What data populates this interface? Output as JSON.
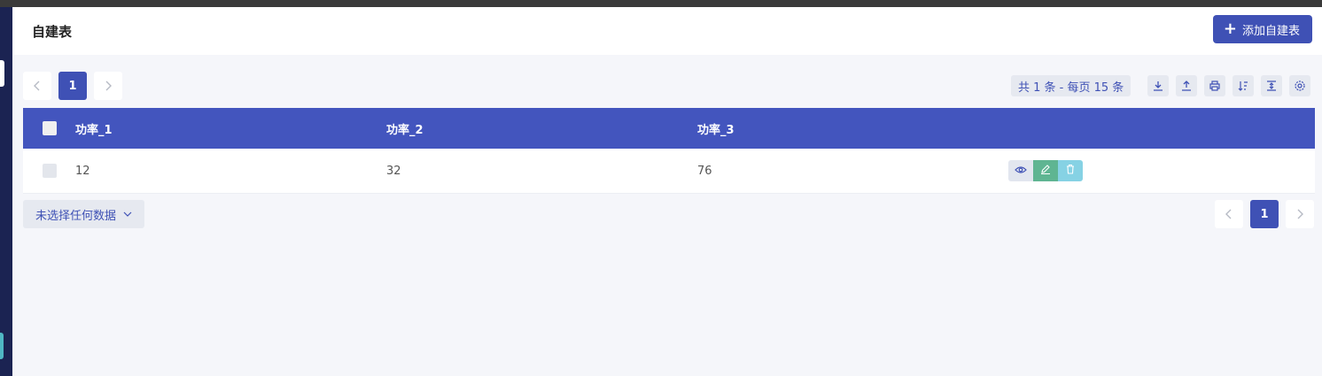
{
  "header": {
    "title": "自建表",
    "add_label": "添加自建表"
  },
  "pagination": {
    "current_page": "1",
    "prev_icon": "chevron-left-icon",
    "next_icon": "chevron-right-icon"
  },
  "summary": {
    "text": "共 1 条 - 每页 15 条"
  },
  "toolbar": {
    "icons": [
      "download-icon",
      "upload-icon",
      "print-icon",
      "sort-icon",
      "column-height-icon",
      "settings-icon"
    ]
  },
  "table": {
    "columns": [
      "功率_1",
      "功率_2",
      "功率_3"
    ],
    "rows": [
      {
        "c1": "12",
        "c2": "32",
        "c3": "76"
      }
    ],
    "row_actions": [
      "eye-icon",
      "edit-icon",
      "trash-icon"
    ]
  },
  "selection": {
    "label": "未选择任何数据"
  },
  "colors": {
    "primary": "#3f51b5",
    "header_bg": "#4355be",
    "edit": "#5fb592",
    "delete": "#86d2e4",
    "sidebar": "#1b2352"
  }
}
